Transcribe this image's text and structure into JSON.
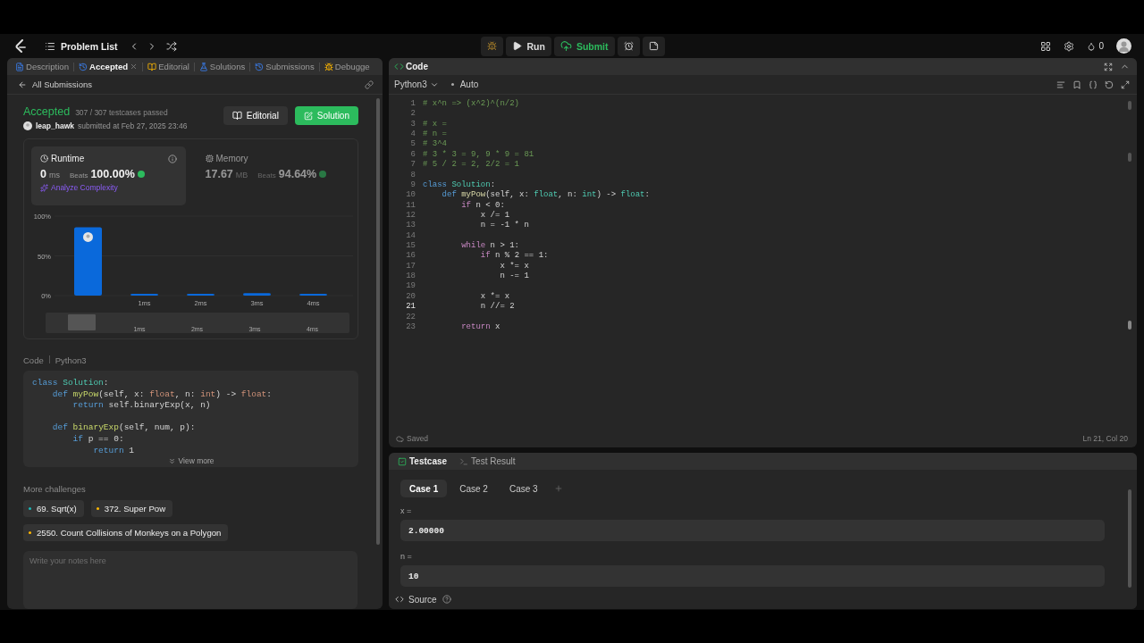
{
  "nav": {
    "title": "Problem List",
    "run": "Run",
    "submit": "Submit",
    "coins": "0"
  },
  "left_tabs": [
    {
      "label": "Description",
      "selected": false,
      "closable": false
    },
    {
      "label": "Accepted",
      "selected": true,
      "closable": true
    },
    {
      "label": "Editorial",
      "selected": false,
      "closable": false
    },
    {
      "label": "Solutions",
      "selected": false,
      "closable": false
    },
    {
      "label": "Submissions",
      "selected": false,
      "closable": false
    },
    {
      "label": "Debugge",
      "selected": false,
      "closable": false
    }
  ],
  "submission": {
    "back": "All Submissions",
    "status": "Accepted",
    "passed": "307 / 307 testcases passed",
    "user": "leap_hawk",
    "submitted": "submitted at Feb 27, 2025 23:46",
    "editorial_button": "Editorial",
    "solution_button": "Solution"
  },
  "stats": [
    {
      "title": "Runtime",
      "value": "0",
      "unit": "ms",
      "beats_label": "Beats",
      "beats": "100.00%",
      "selected": true,
      "analyze": "Analyze Complexity"
    },
    {
      "title": "Memory",
      "value": "17.67",
      "unit": "MB",
      "beats_label": "Beats",
      "beats": "94.64%",
      "selected": false
    }
  ],
  "chart_data": {
    "type": "bar",
    "categories": [
      null,
      "1ms",
      "2ms",
      "3ms",
      "4ms"
    ],
    "values": [
      86,
      2,
      2,
      3,
      2
    ],
    "ylim": [
      0,
      100
    ],
    "yticks": [
      {
        "value": 0,
        "label": "0%"
      },
      {
        "value": 50,
        "label": "50%"
      },
      {
        "value": 100,
        "label": "100%"
      }
    ]
  },
  "navigator_labels": [
    "1ms",
    "2ms",
    "3ms",
    "4ms"
  ],
  "code_preview": {
    "label": "Code",
    "language": "Python3",
    "view_more": "View more",
    "lines": [
      {
        "blank": false,
        "tokens": [
          {
            "t": "class",
            "kind": "kw"
          },
          {
            "t": " Solution",
            "kind": "cls"
          },
          {
            "t": ":",
            "kind": "pl"
          }
        ]
      },
      {
        "blank": false,
        "tokens": [
          {
            "t": "    def",
            "kind": "kw"
          },
          {
            "t": " myPow",
            "kind": "fn"
          },
          {
            "t": "(self, x: ",
            "kind": "pl"
          },
          {
            "t": "float",
            "kind": "ty"
          },
          {
            "t": ", n: ",
            "kind": "pl"
          },
          {
            "t": "int",
            "kind": "ty"
          },
          {
            "t": ") -> ",
            "kind": "pl"
          },
          {
            "t": "float",
            "kind": "ty"
          },
          {
            "t": ":",
            "kind": "pl"
          }
        ]
      },
      {
        "blank": false,
        "tokens": [
          {
            "t": "        return",
            "kind": "kw"
          },
          {
            "t": " self.binaryExp(x, n)",
            "kind": "pl"
          }
        ]
      },
      {
        "blank": true
      },
      {
        "blank": false,
        "tokens": [
          {
            "t": "    def",
            "kind": "kw"
          },
          {
            "t": " binaryExp",
            "kind": "fn"
          },
          {
            "t": "(self, num, p):",
            "kind": "pl"
          }
        ]
      },
      {
        "blank": false,
        "tokens": [
          {
            "t": "        if",
            "kind": "kw"
          },
          {
            "t": " p == 0:",
            "kind": "pl"
          }
        ]
      },
      {
        "blank": false,
        "tokens": [
          {
            "t": "            return",
            "kind": "kw"
          },
          {
            "t": " 1",
            "kind": "pl"
          }
        ]
      }
    ]
  },
  "more_challenges": {
    "title": "More challenges",
    "items": [
      {
        "label": "69. Sqrt(x)",
        "color": "#1cb8b8"
      },
      {
        "label": "372. Super Pow",
        "color": "#ffb800"
      },
      {
        "label": "2550. Count Collisions of Monkeys on a Polygon",
        "color": "#ffb800"
      }
    ]
  },
  "notes": {
    "placeholder": "Write your notes here"
  },
  "editor": {
    "title": "Code",
    "language": "Python3",
    "mode": "Auto",
    "saved": "Saved",
    "cursor": "Ln 21, Col 20",
    "lines": [
      {
        "number": "1",
        "selected": false,
        "tokens": [
          {
            "t": "# x^n => (x^2)^(n/2)",
            "kind": "cm"
          }
        ]
      },
      {
        "number": "2",
        "selected": false
      },
      {
        "number": "3",
        "selected": false,
        "tokens": [
          {
            "t": "# x =",
            "kind": "cm"
          }
        ]
      },
      {
        "number": "4",
        "selected": false,
        "tokens": [
          {
            "t": "# n =",
            "kind": "cm"
          }
        ]
      },
      {
        "number": "5",
        "selected": false,
        "tokens": [
          {
            "t": "# 3^4",
            "kind": "cm"
          }
        ]
      },
      {
        "number": "6",
        "selected": false,
        "tokens": [
          {
            "t": "# 3 * 3 = 9, 9 * 9 = 81",
            "kind": "cm"
          }
        ]
      },
      {
        "number": "7",
        "selected": false,
        "tokens": [
          {
            "t": "# 5 / 2 = 2, 2/2 = 1",
            "kind": "cm"
          }
        ]
      },
      {
        "number": "8",
        "selected": false
      },
      {
        "number": "9",
        "selected": false,
        "tokens": [
          {
            "t": "class",
            "kind": "kw"
          },
          {
            "t": " Solution",
            "kind": "cls"
          },
          {
            "t": ":",
            "kind": "pl"
          }
        ]
      },
      {
        "number": "10",
        "selected": false,
        "tokens": [
          {
            "t": "    def",
            "kind": "kw"
          },
          {
            "t": " myPow",
            "kind": "fn"
          },
          {
            "t": "(self, x: ",
            "kind": "pl"
          },
          {
            "t": "float",
            "kind": "ty"
          },
          {
            "t": ", n: ",
            "kind": "pl"
          },
          {
            "t": "int",
            "kind": "ty"
          },
          {
            "t": ") -> ",
            "kind": "pl"
          },
          {
            "t": "float",
            "kind": "ty"
          },
          {
            "t": ":",
            "kind": "pl"
          }
        ]
      },
      {
        "number": "11",
        "selected": false,
        "tokens": [
          {
            "t": "        if",
            "kind": "ct"
          },
          {
            "t": " n < 0:",
            "kind": "pl"
          }
        ]
      },
      {
        "number": "12",
        "selected": false,
        "tokens": [
          {
            "t": "            x /= 1",
            "kind": "pl"
          }
        ]
      },
      {
        "number": "13",
        "selected": false,
        "tokens": [
          {
            "t": "            n = -1 * n",
            "kind": "pl"
          }
        ]
      },
      {
        "number": "14",
        "selected": false
      },
      {
        "number": "15",
        "selected": false,
        "tokens": [
          {
            "t": "        while",
            "kind": "ct"
          },
          {
            "t": " n > 1:",
            "kind": "pl"
          }
        ]
      },
      {
        "number": "16",
        "selected": false,
        "tokens": [
          {
            "t": "            if",
            "kind": "ct"
          },
          {
            "t": " n % 2 == 1:",
            "kind": "pl"
          }
        ]
      },
      {
        "number": "17",
        "selected": false,
        "tokens": [
          {
            "t": "                x *= x",
            "kind": "pl"
          }
        ]
      },
      {
        "number": "18",
        "selected": false,
        "tokens": [
          {
            "t": "                n -= 1",
            "kind": "pl"
          }
        ]
      },
      {
        "number": "19",
        "selected": false
      },
      {
        "number": "20",
        "selected": false,
        "tokens": [
          {
            "t": "            x *= x",
            "kind": "pl"
          }
        ]
      },
      {
        "number": "21",
        "selected": true,
        "tokens": [
          {
            "t": "            n //= 2",
            "kind": "pl"
          }
        ]
      },
      {
        "number": "22",
        "selected": false
      },
      {
        "number": "23",
        "selected": false,
        "tokens": [
          {
            "t": "        return",
            "kind": "ct"
          },
          {
            "t": " x",
            "kind": "pl"
          }
        ]
      }
    ]
  },
  "testcase": {
    "tabs": [
      {
        "label": "Testcase",
        "selected": true
      },
      {
        "label": "Test Result",
        "selected": false
      }
    ],
    "cases": [
      {
        "label": "Case 1",
        "selected": true
      },
      {
        "label": "Case 2",
        "selected": false
      },
      {
        "label": "Case 3",
        "selected": false
      }
    ],
    "inputs": [
      {
        "name": "x =",
        "value": "2.00000"
      },
      {
        "name": "n =",
        "value": "10"
      }
    ],
    "source": "Source"
  }
}
